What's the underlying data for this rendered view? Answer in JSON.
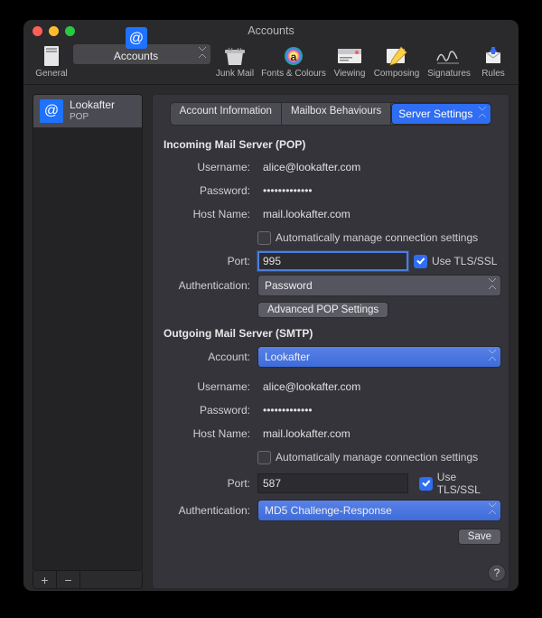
{
  "window": {
    "title": "Accounts"
  },
  "traffic": {
    "close": "#ff5f57",
    "min": "#febc2e",
    "max": "#28c840"
  },
  "toolbar": {
    "general": "General",
    "accounts": "Accounts",
    "junk": "Junk Mail",
    "fonts": "Fonts & Colours",
    "viewing": "Viewing",
    "composing": "Composing",
    "signatures": "Signatures",
    "rules": "Rules"
  },
  "sidebar": {
    "account": {
      "name": "Lookafter",
      "protocol": "POP",
      "glyph": "@"
    },
    "add": "+",
    "remove": "−"
  },
  "tabs": {
    "info": "Account Information",
    "mailbox": "Mailbox Behaviours",
    "server": "Server Settings"
  },
  "incoming": {
    "heading": "Incoming Mail Server (POP)",
    "username_label": "Username:",
    "username": "alice@lookafter.com",
    "password_label": "Password:",
    "password": "•••••••••••••",
    "host_label": "Host Name:",
    "host": "mail.lookafter.com",
    "auto_label": "Automatically manage connection settings",
    "auto_checked": false,
    "port_label": "Port:",
    "port": "995",
    "tls_label": "Use TLS/SSL",
    "tls_checked": true,
    "auth_label": "Authentication:",
    "auth_value": "Password",
    "advanced_btn": "Advanced POP Settings"
  },
  "outgoing": {
    "heading": "Outgoing Mail Server (SMTP)",
    "account_label": "Account:",
    "account_value": "Lookafter",
    "username_label": "Username:",
    "username": "alice@lookafter.com",
    "password_label": "Password:",
    "password": "•••••••••••••",
    "host_label": "Host Name:",
    "host": "mail.lookafter.com",
    "auto_label": "Automatically manage connection settings",
    "auto_checked": false,
    "port_label": "Port:",
    "port": "587",
    "tls_label": "Use TLS/SSL",
    "tls_checked": true,
    "auth_label": "Authentication:",
    "auth_value": "MD5 Challenge-Response"
  },
  "save_btn": "Save",
  "help": "?"
}
